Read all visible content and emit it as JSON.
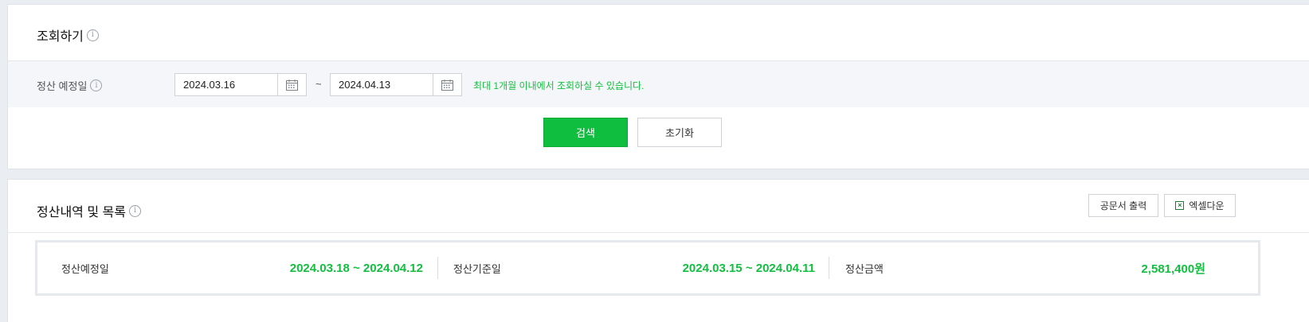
{
  "search_panel": {
    "title": "조회하기",
    "filter": {
      "label": "정산 예정일",
      "start_date": "2024.03.16",
      "separator": "~",
      "end_date": "2024.04.13",
      "hint": "최대 1개월 이내에서 조회하실 수 있습니다."
    },
    "search_label": "검색",
    "reset_label": "초기화"
  },
  "list_panel": {
    "title": "정산내역 및 목록",
    "print_label": "공문서 출력",
    "excel_label": "엑셀다운",
    "summary": [
      {
        "label": "정산예정일",
        "value": "2024.03.18 ~ 2024.04.12"
      },
      {
        "label": "정산기준일",
        "value": "2024.03.15 ~ 2024.04.11"
      },
      {
        "label": "정산금액",
        "value": "2,581,400원"
      }
    ]
  },
  "colors": {
    "accent": "#0fbe3e",
    "value_green": "#12bf3f",
    "background": "#eaedf1"
  },
  "icons": [
    "info-icon",
    "calendar-icon",
    "excel-icon"
  ]
}
